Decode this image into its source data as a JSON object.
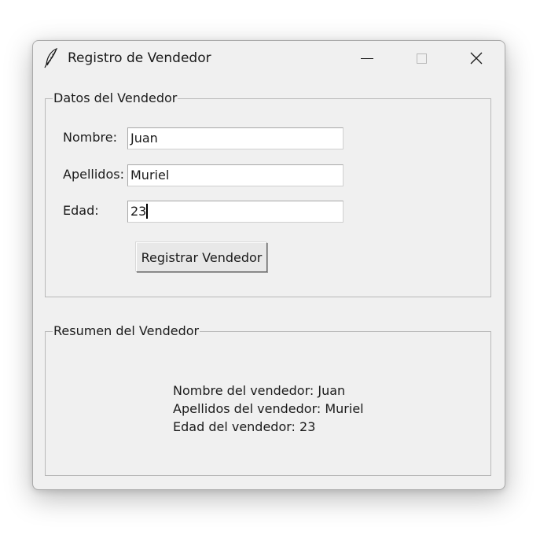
{
  "window": {
    "title": "Registro de Vendedor",
    "icon": "feather-icon",
    "controls": [
      "minimize-icon",
      "maximize-icon",
      "close-icon"
    ]
  },
  "datos": {
    "title": "Datos del Vendedor",
    "nombre_label": "Nombre:",
    "nombre_value": "Juan",
    "apellidos_label": "Apellidos:",
    "apellidos_value": "Muriel",
    "edad_label": "Edad:",
    "edad_value": "23",
    "register_button": "Registrar Vendedor"
  },
  "resumen": {
    "title": "Resumen del Vendedor",
    "line1": "Nombre del vendedor: Juan",
    "line2": "Apellidos del vendedor: Muriel",
    "line3": "Edad del vendedor: 23"
  }
}
